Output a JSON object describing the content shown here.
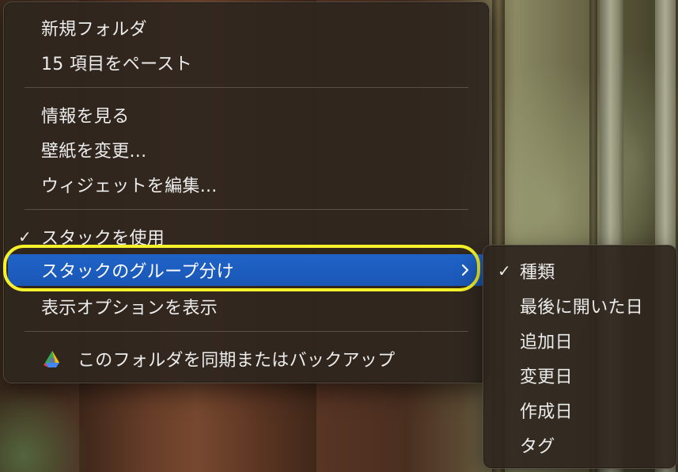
{
  "context_menu": {
    "items": [
      {
        "label": "新規フォルダ"
      },
      {
        "label": "15 項目をペースト"
      },
      {
        "label": "情報を見る"
      },
      {
        "label": "壁紙を変更..."
      },
      {
        "label": "ウィジェットを編集..."
      },
      {
        "label": "スタックを使用",
        "checked": true
      },
      {
        "label": "スタックのグループ分け",
        "highlighted": true,
        "has_submenu": true
      },
      {
        "label": "表示オプションを表示"
      },
      {
        "label": "このフォルダを同期またはバックアップ",
        "icon": "google-drive-icon"
      }
    ],
    "check_glyph": "✓"
  },
  "group_by_submenu": {
    "items": [
      {
        "label": "種類",
        "checked": true
      },
      {
        "label": "最後に開いた日"
      },
      {
        "label": "追加日"
      },
      {
        "label": "変更日"
      },
      {
        "label": "作成日"
      },
      {
        "label": "タグ"
      }
    ]
  },
  "colors": {
    "highlight": "#1f63c8",
    "focus_ring": "#f5f12a",
    "menu_bg": "#2e261e",
    "text": "#ececec"
  }
}
